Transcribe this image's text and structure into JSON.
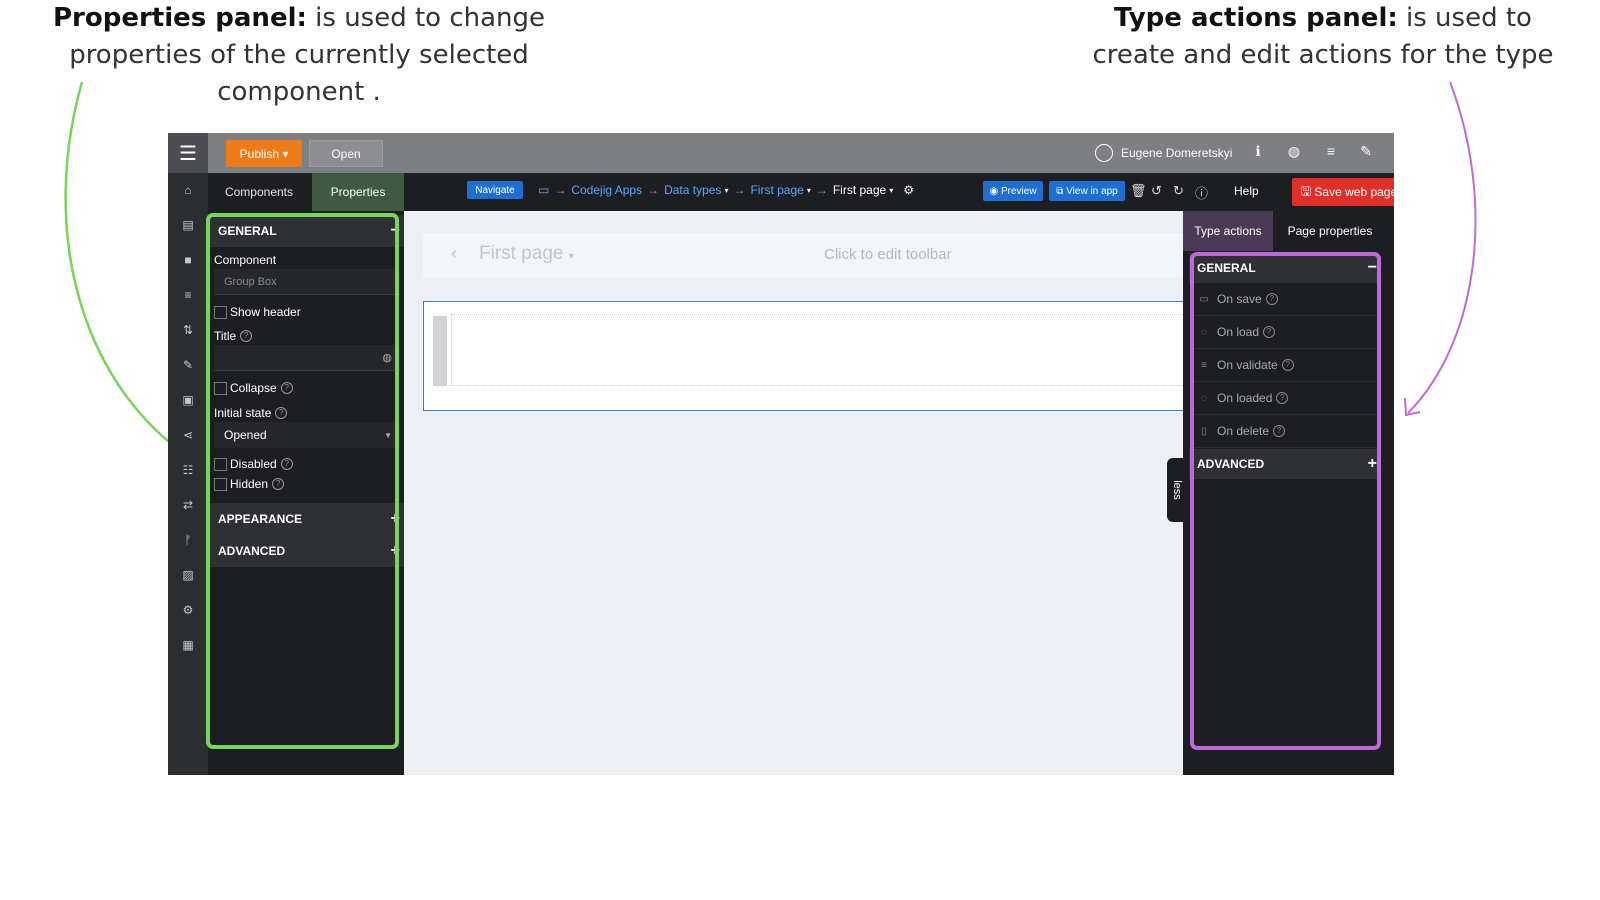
{
  "callouts": {
    "left": {
      "bold": "Properties panel:",
      "text": " is used to change properties of the currently selected component ."
    },
    "right": {
      "bold": "Type actions panel:",
      "text": " is used to create and edit actions for the type"
    }
  },
  "colors": {
    "green_highlight": "#76d65a",
    "purple_highlight": "#c067dc",
    "publish": "#f07a1a",
    "save": "#e0302a",
    "accent": "#1e6fd1"
  },
  "topbar": {
    "publish_label": "Publish",
    "open_label": "Open",
    "user_name": "Eugene Domeretskyi",
    "icons": [
      "menu-icon",
      "info-icon",
      "globe-icon",
      "list-icon",
      "wrench-icon"
    ]
  },
  "sidebar": {
    "icons": [
      "home-icon",
      "database-icon",
      "lock-icon",
      "menu-icon",
      "sort-icon",
      "pencil-icon",
      "archive-icon",
      "share-icon",
      "list-icon",
      "transfer-icon",
      "branch-icon",
      "image-icon",
      "gear-icon",
      "grid-icon"
    ]
  },
  "tabs": {
    "components": "Components",
    "properties": "Properties"
  },
  "toolbar": {
    "navigate_label": "Navigate",
    "breadcrumb": [
      "Codejig Apps",
      "Data types",
      "First page",
      "First page"
    ],
    "preview_label": "Preview",
    "view_in_app_label": "View in app",
    "help_label": "Help",
    "save_label": "Save web page"
  },
  "properties": {
    "general_header": "GENERAL",
    "component_label": "Component",
    "component_value": "Group Box",
    "show_header_label": "Show header",
    "title_label": "Title",
    "collapse_label": "Collapse",
    "initial_state_label": "Initial state",
    "initial_state_value": "Opened",
    "disabled_label": "Disabled",
    "hidden_label": "Hidden",
    "appearance_header": "APPEARANCE",
    "advanced_header": "ADVANCED"
  },
  "canvas": {
    "page_title": "First page",
    "toolbar_hint": "Click to edit toolbar",
    "less_label": "less"
  },
  "right_panel": {
    "tab_type_actions": "Type actions",
    "tab_page_properties": "Page properties",
    "general_header": "GENERAL",
    "actions": [
      {
        "label": "On save",
        "icon": "save-icon"
      },
      {
        "label": "On load",
        "icon": "spinner-icon"
      },
      {
        "label": "On validate",
        "icon": "validate-icon"
      },
      {
        "label": "On loaded",
        "icon": "spinner-icon"
      },
      {
        "label": "On delete",
        "icon": "trash-icon"
      }
    ],
    "advanced_header": "ADVANCED"
  }
}
